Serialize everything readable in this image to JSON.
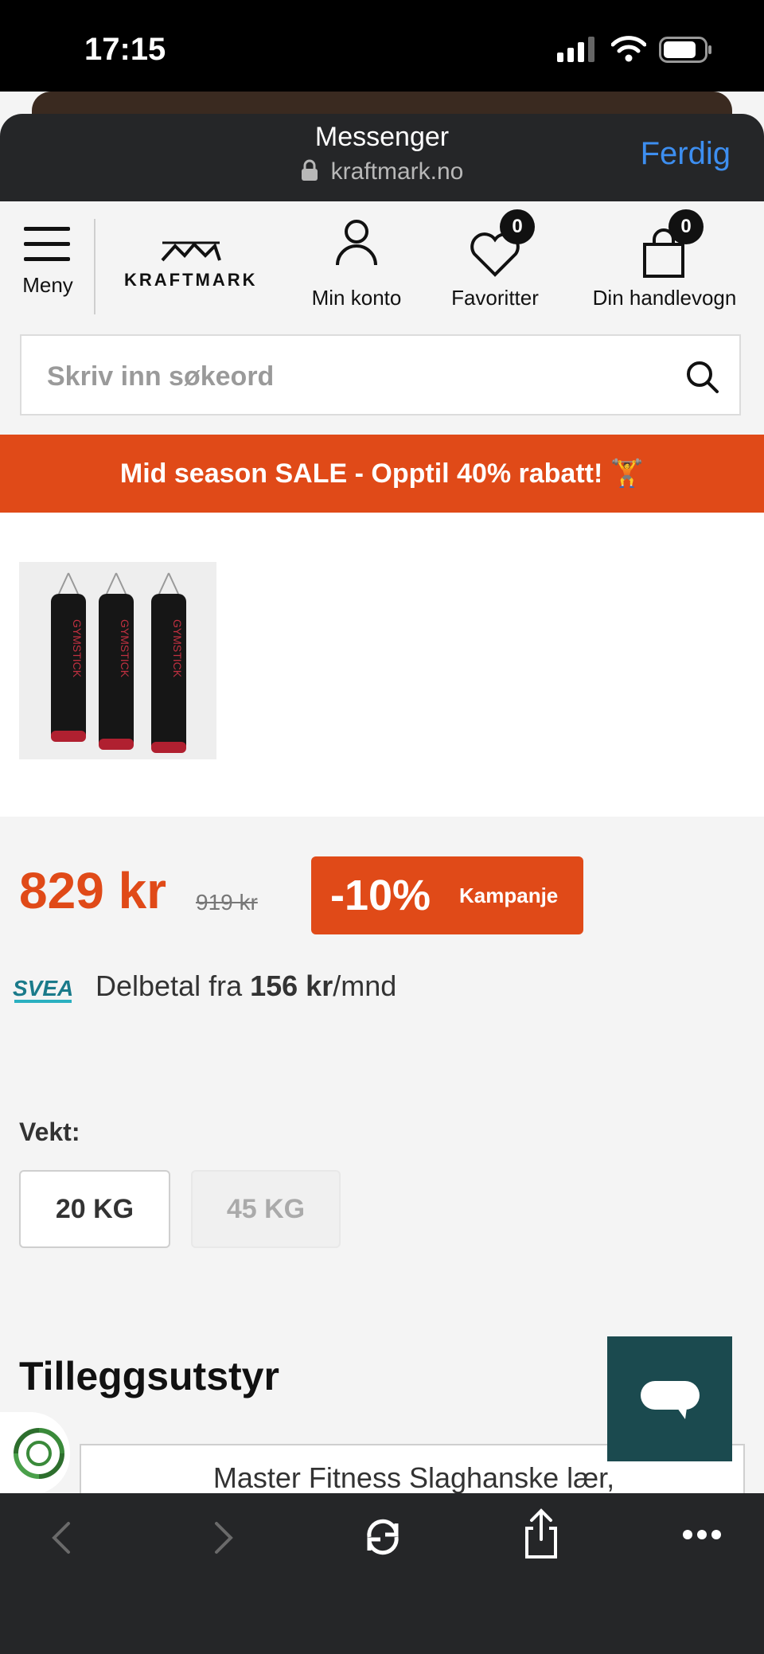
{
  "status_bar": {
    "time": "17:15"
  },
  "browser": {
    "title": "Messenger",
    "url": "kraftmark.no",
    "done_label": "Ferdig"
  },
  "site_header": {
    "menu_label": "Meny",
    "logo_text": "KRAFTMARK",
    "account_label": "Min konto",
    "favorites_label": "Favoritter",
    "favorites_count": "0",
    "cart_label": "Din handlevogn",
    "cart_count": "0"
  },
  "search": {
    "placeholder": "Skriv inn søkeord"
  },
  "banner": {
    "text": "Mid season SALE - Opptil 40% rabatt! 🏋️"
  },
  "product": {
    "price": "829 kr",
    "old_price": "919 kr",
    "discount_pct": "-10%",
    "discount_label": "Kampanje",
    "svea_logo": "SVEA",
    "installment_prefix": "Delbetal fra ",
    "installment_amount": "156 kr",
    "installment_suffix": "/mnd",
    "weight_label": "Vekt:",
    "weight_options": [
      "20 KG",
      "45 KG"
    ],
    "thumbnail_brand": "GYMSTICK"
  },
  "addons": {
    "heading": "Tilleggsutstyr",
    "first_item": "Master Fitness Slaghanske lær,"
  },
  "colors": {
    "accent": "#e04a18",
    "chat": "#1b4a4f",
    "browser_bg": "#252628",
    "link": "#3d8ef0"
  }
}
